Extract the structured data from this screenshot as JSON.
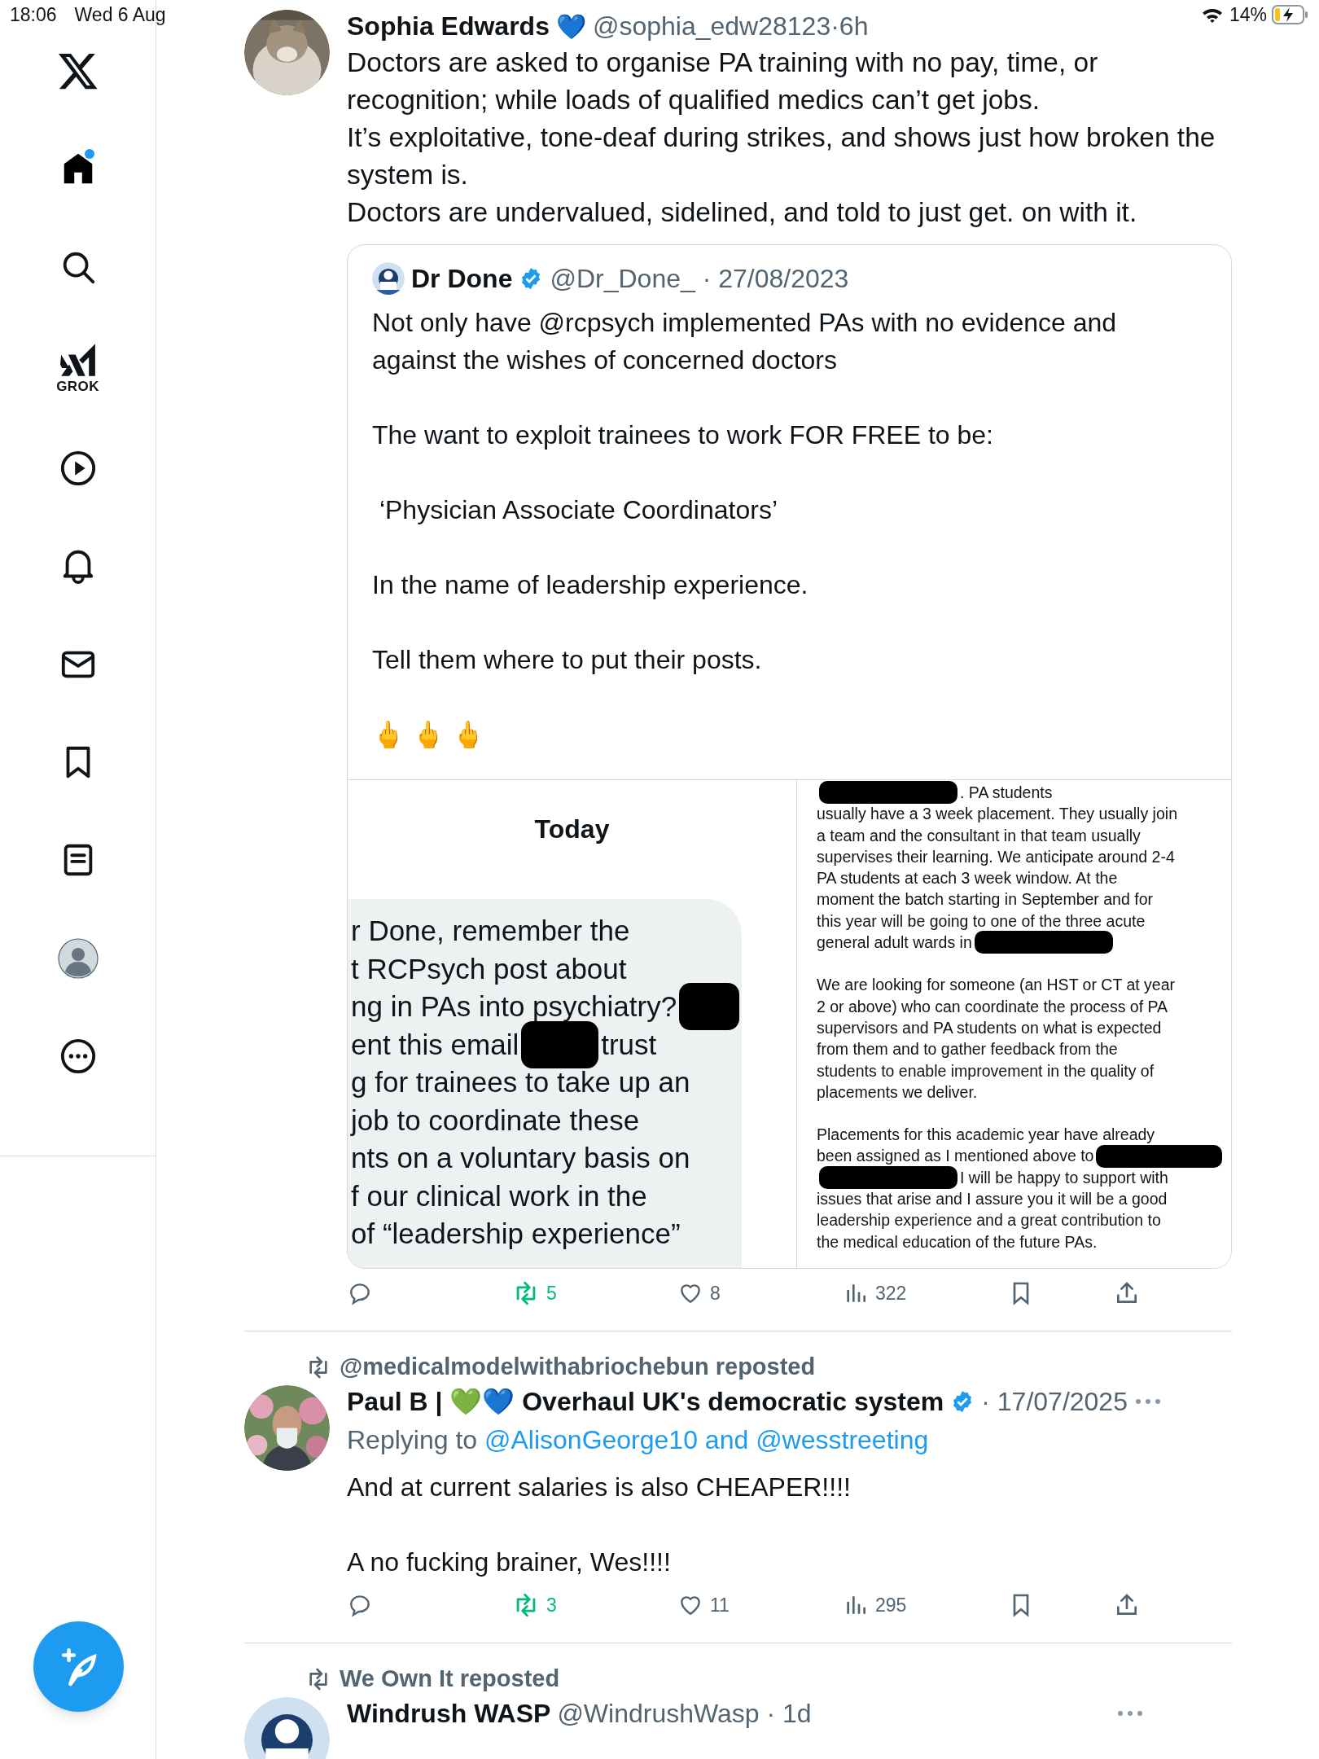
{
  "status_bar": {
    "time": "18:06",
    "date": "Wed 6 Aug",
    "battery": "14%",
    "charging": true
  },
  "sidebar": {
    "items": [
      {
        "kind": "logo",
        "selected": false
      },
      {
        "kind": "home",
        "selected": true,
        "badge": true
      },
      {
        "kind": "search",
        "selected": false
      },
      {
        "kind": "grok",
        "label": "GROK",
        "selected": false
      },
      {
        "kind": "video",
        "selected": false
      },
      {
        "kind": "notifications",
        "selected": false
      },
      {
        "kind": "messages",
        "selected": false
      },
      {
        "kind": "bookmarks",
        "selected": false
      },
      {
        "kind": "lists",
        "selected": false
      },
      {
        "kind": "profile",
        "selected": false
      },
      {
        "kind": "more",
        "selected": false
      }
    ],
    "compose": {
      "kind": "compose"
    }
  },
  "tweets": [
    {
      "name": "Sophia Edwards",
      "name_emoji": "💙",
      "meta": "@sophia_edw28123·6h",
      "text": [
        "Doctors are asked to organise PA training with no pay, time, or recognition; while loads of qualified medics can’t get jobs.",
        "It’s exploitative, tone-deaf during strikes, and shows just how broken the system is.",
        "Doctors are undervalued, sidelined, and told to just get. on with it."
      ],
      "quote": {
        "name": "Dr Done",
        "verified": true,
        "meta": "@Dr_Done_ · 27/08/2023",
        "paragraphs": [
          "Not only have @rcpsych implemented PAs with no evidence and against the wishes of concerned doctors",
          "The want to exploit trainees to work FOR FREE to be:",
          " ‘Physician Associate Coordinators’",
          "In the name of leadership experience.",
          "Tell them where to put their posts.",
          "🖕 🖕 🖕"
        ],
        "chat_image": {
          "heading": "Today",
          "lines": [
            [
              {
                "kind": "text",
                "text": "r Done, remember the"
              }
            ],
            [
              {
                "kind": "text",
                "text": "t RCPsych post about"
              }
            ],
            [
              {
                "kind": "text",
                "text": "ng in PAs into psychiatry?"
              },
              {
                "kind": "redacted"
              }
            ],
            [
              {
                "kind": "text",
                "text": "ent this email"
              },
              {
                "kind": "redacted"
              },
              {
                "kind": "text",
                "text": "trust"
              }
            ],
            [
              {
                "kind": "text",
                "text": "g for trainees to take up an"
              }
            ],
            [
              {
                "kind": "text",
                "text": "job to coordinate these"
              }
            ],
            [
              {
                "kind": "text",
                "text": "nts on a voluntary basis on"
              }
            ],
            [
              {
                "kind": "text",
                "text": "f our clinical work in the"
              }
            ],
            [
              {
                "kind": "text",
                "text": "of “leadership experience”"
              }
            ]
          ]
        },
        "doc_image": {
          "paragraphs": [
            [
              [
                {
                  "kind": "redacted"
                },
                {
                  "kind": "text",
                  "text": ". PA students"
                }
              ],
              [
                {
                  "kind": "text",
                  "text": "usually have a 3 week placement. They usually join"
                }
              ],
              [
                {
                  "kind": "text",
                  "text": "a team and the consultant in that team usually"
                }
              ],
              [
                {
                  "kind": "text",
                  "text": "supervises their learning. We anticipate around 2-4"
                }
              ],
              [
                {
                  "kind": "text",
                  "text": "PA students at each 3 week window. At the"
                }
              ],
              [
                {
                  "kind": "text",
                  "text": "moment the batch starting in September and for"
                }
              ],
              [
                {
                  "kind": "text",
                  "text": "this year will be going to one of the three acute"
                }
              ],
              [
                {
                  "kind": "text",
                  "text": "general adult wards in"
                },
                {
                  "kind": "redacted"
                }
              ]
            ],
            [
              [
                {
                  "kind": "text",
                  "text": "We are looking for someone (an HST or CT at year"
                }
              ],
              [
                {
                  "kind": "text",
                  "text": "2 or above) who can coordinate the process of PA"
                }
              ],
              [
                {
                  "kind": "text",
                  "text": "supervisors and PA students on what is expected"
                }
              ],
              [
                {
                  "kind": "text",
                  "text": "from them and to gather feedback from the"
                }
              ],
              [
                {
                  "kind": "text",
                  "text": "students to enable improvement in the quality of"
                }
              ],
              [
                {
                  "kind": "text",
                  "text": "placements we deliver."
                }
              ]
            ],
            [
              [
                {
                  "kind": "text",
                  "text": "Placements for this academic year have already"
                }
              ],
              [
                {
                  "kind": "text",
                  "text": "been assigned as I mentioned above to"
                },
                {
                  "kind": "redacted"
                }
              ],
              [
                {
                  "kind": "redacted"
                },
                {
                  "kind": "text",
                  "text": "I will be happy to support with"
                }
              ],
              [
                {
                  "kind": "text",
                  "text": "issues that arise and I assure you it will be a good"
                }
              ],
              [
                {
                  "kind": "text",
                  "text": "leadership experience and a great contribution to"
                }
              ],
              [
                {
                  "kind": "text",
                  "text": "the medical education of the future PAs."
                }
              ]
            ]
          ]
        }
      },
      "stats": {
        "reposts": "5",
        "reposted": true,
        "likes": "8",
        "liked": false,
        "views": "322"
      }
    },
    {
      "repost_by": "@medicalmodelwithabriochebun reposted",
      "name": "Paul B | 💚💙 Overhaul UK's democratic system",
      "verified": true,
      "meta": "· 17/07/2025",
      "more": true,
      "replying_label": "Replying to",
      "replying_to": "@AlisonGeorge10 and @wesstreeting",
      "paragraphs": [
        "And at current salaries is also CHEAPER!!!!",
        "A no fucking brainer, Wes!!!!"
      ],
      "stats": {
        "reposts": "3",
        "reposted": true,
        "likes": "11",
        "liked": false,
        "views": "295"
      }
    },
    {
      "repost_by": "We Own It reposted",
      "name": "Windrush WASP",
      "meta": "@WindrushWasp · 1d",
      "more": true
    }
  ]
}
